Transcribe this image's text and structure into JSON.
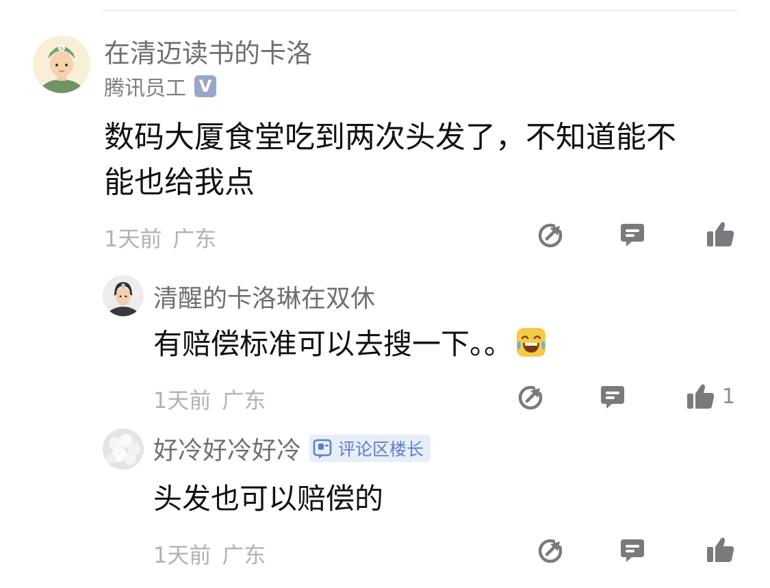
{
  "comments": [
    {
      "author": "在清迈读书的卡洛",
      "role": "腾讯员工",
      "verified_mark": "V",
      "text_lines": [
        "数码大厦食堂吃到两次头发了，不知道能不",
        "能也给我点"
      ],
      "time": "1天前",
      "location": "广东",
      "likes": ""
    },
    {
      "author": "清醒的卡洛琳在双休",
      "text_lines": [
        "有赔偿标准可以去搜一下。。"
      ],
      "emoji": "laughing-tears-emoji",
      "time": "1天前",
      "location": "广东",
      "likes": "1"
    },
    {
      "author": "好冷好冷好冷",
      "badge": "评论区楼长",
      "text_lines": [
        "头发也可以赔偿的"
      ],
      "time": "1天前",
      "location": "广东",
      "likes": ""
    }
  ],
  "icons": {
    "share": "share-icon",
    "reply": "reply-icon",
    "like": "thumbs-up-icon"
  },
  "colors": {
    "text": "#111111",
    "meta": "#b2b2b6",
    "icon": "#7a7a7e",
    "badge_blue": "#5b7fc7"
  }
}
